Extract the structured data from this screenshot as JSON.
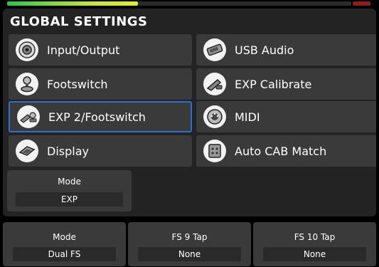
{
  "title": "GLOBAL SETTINGS",
  "menu": [
    {
      "label": "Input/Output",
      "icon": "input-output-icon"
    },
    {
      "label": "USB Audio",
      "icon": "usb-audio-icon"
    },
    {
      "label": "Footswitch",
      "icon": "footswitch-icon"
    },
    {
      "label": "EXP Calibrate",
      "icon": "exp-calibrate-icon"
    },
    {
      "label": "EXP 2/Footswitch",
      "icon": "exp2-footswitch-icon",
      "selected": true
    },
    {
      "label": "MIDI",
      "icon": "midi-icon"
    },
    {
      "label": "Display",
      "icon": "display-icon"
    },
    {
      "label": "Auto CAB Match",
      "icon": "auto-cab-match-icon"
    }
  ],
  "mode_panel": {
    "caption": "Mode",
    "value": "EXP"
  },
  "bottom": [
    {
      "caption": "Mode",
      "value": "Dual FS"
    },
    {
      "caption": "FS 9 Tap",
      "value": "None"
    },
    {
      "caption": "FS 10 Tap",
      "value": "None"
    }
  ],
  "colors": {
    "accent": "#2f6fd0",
    "panel": "#232323",
    "item": "#3a3a3a"
  }
}
